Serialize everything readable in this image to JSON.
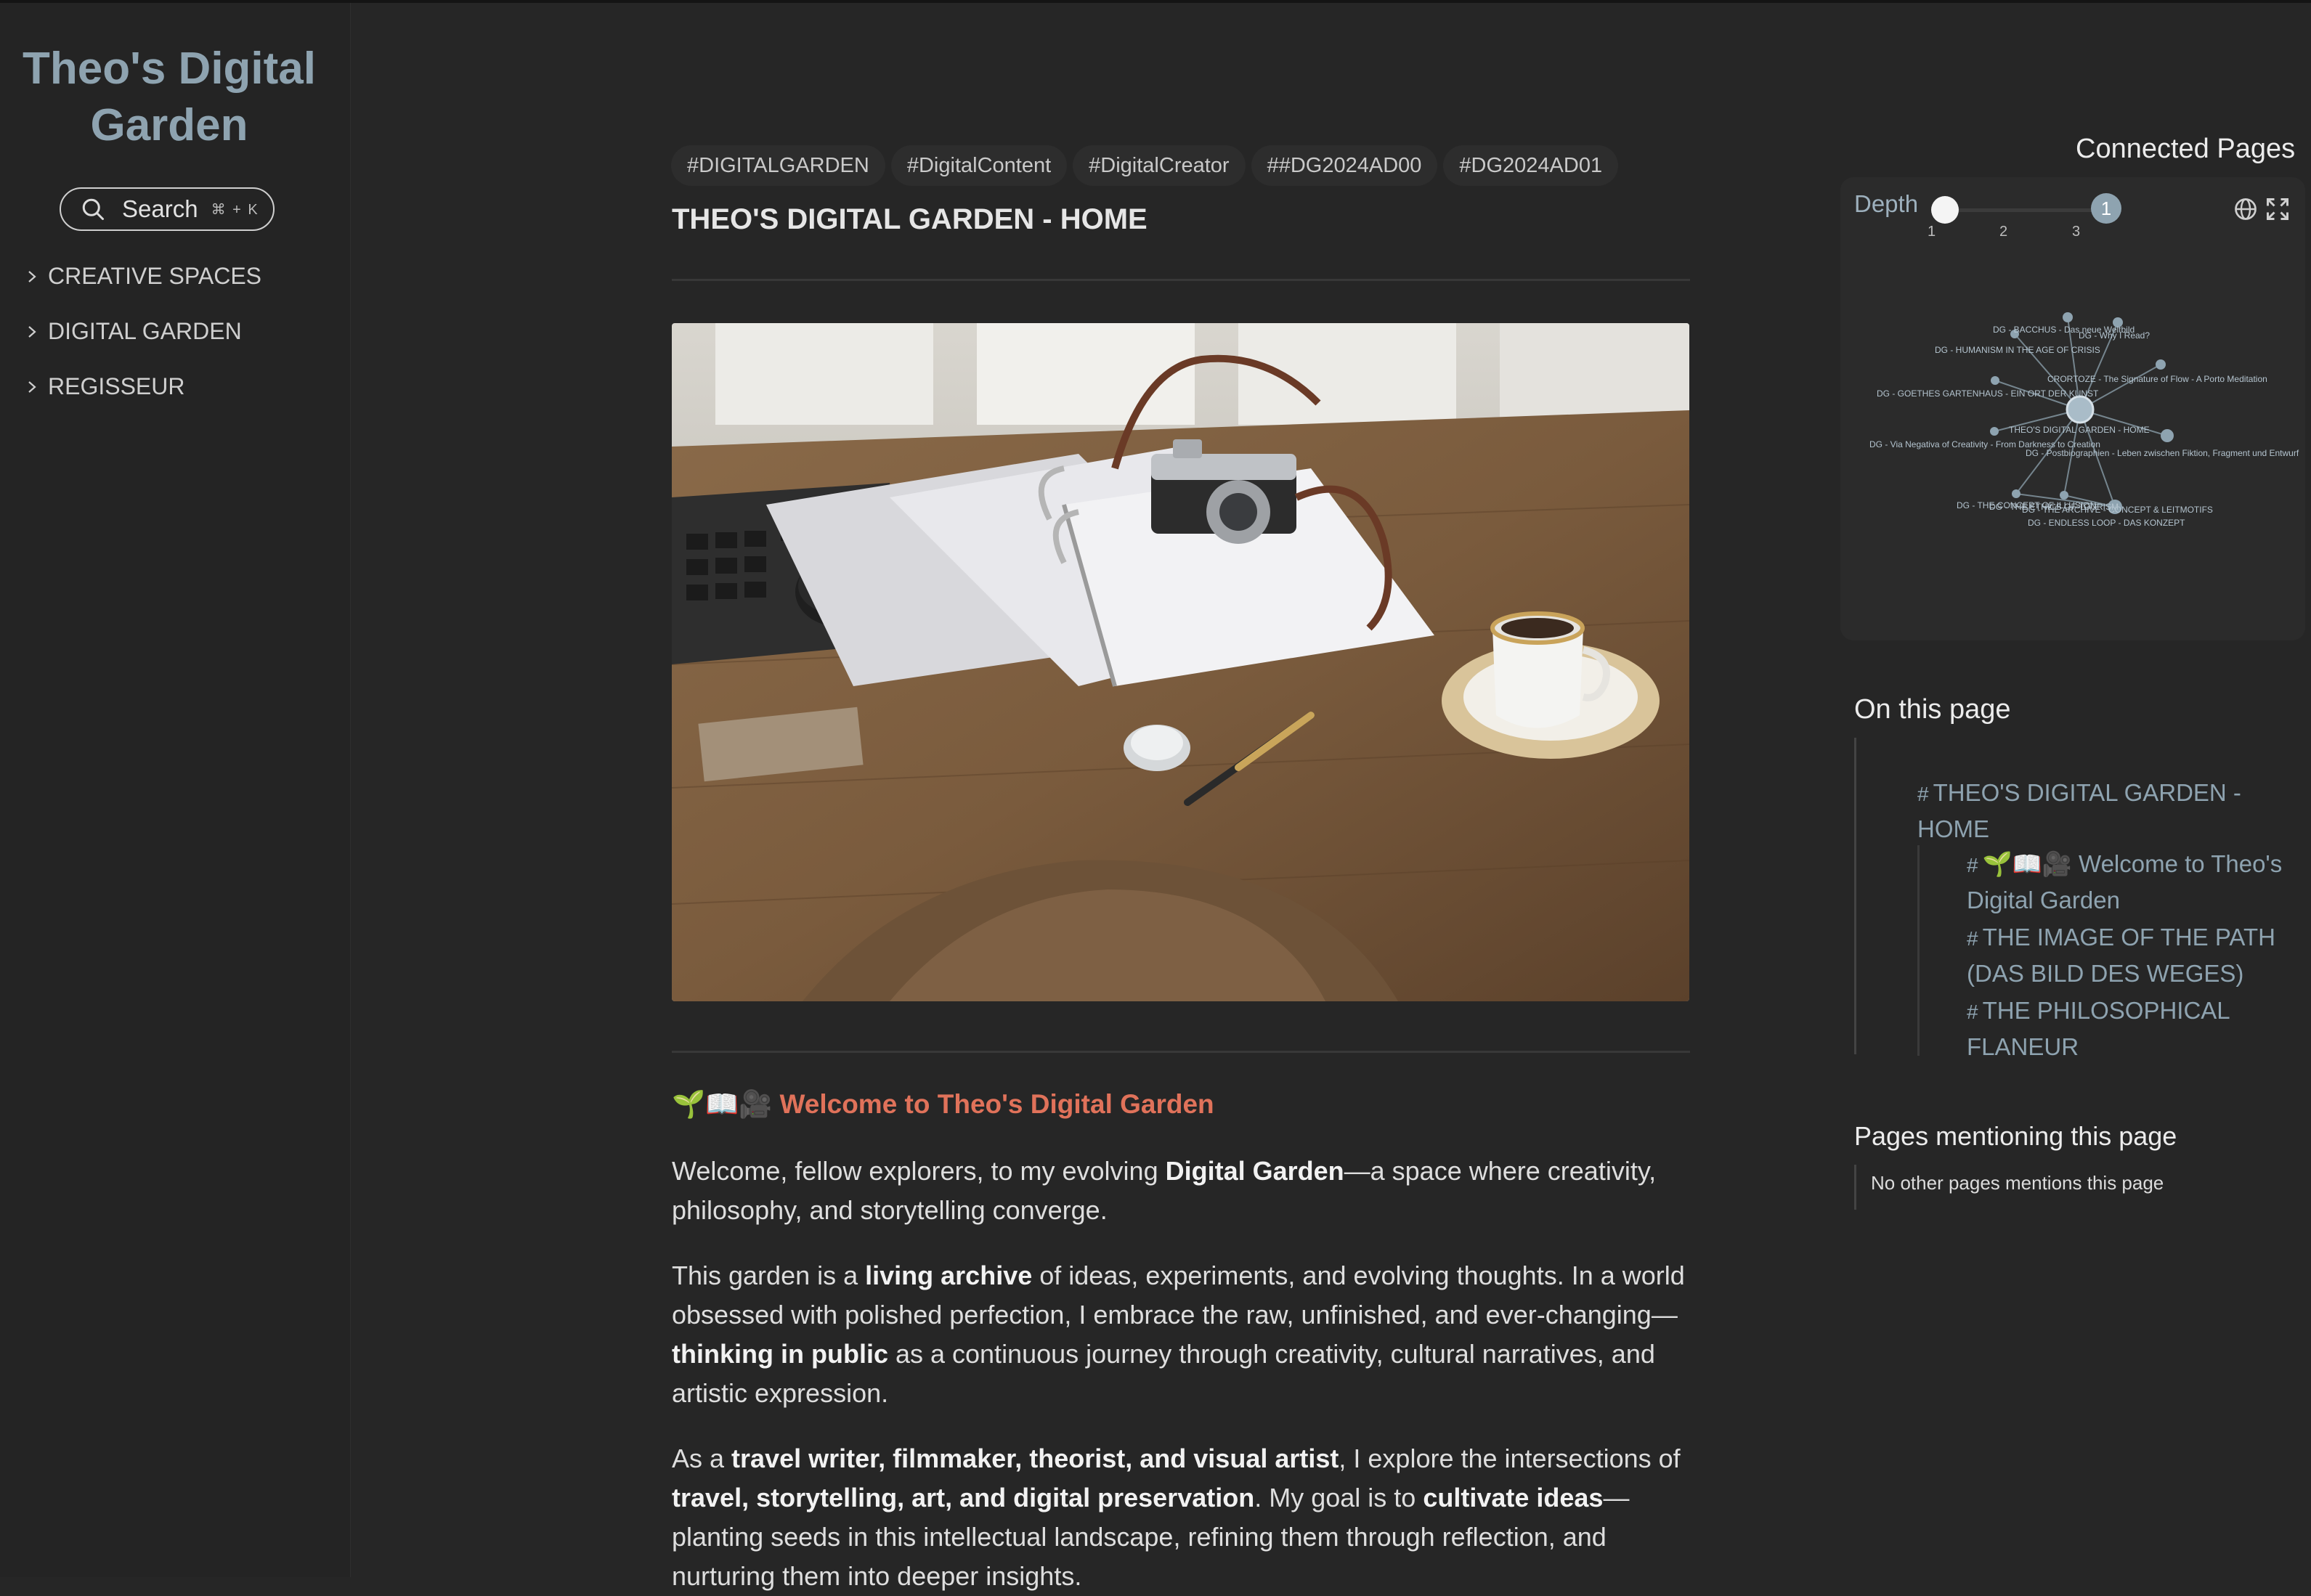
{
  "sidebar": {
    "title": "Theo's Digital Garden",
    "search_label": "Search",
    "search_shortcut": "⌘ + K",
    "nav_items": [
      {
        "label": "CREATIVE SPACES"
      },
      {
        "label": "DIGITAL GARDEN"
      },
      {
        "label": "REGISSEUR"
      }
    ]
  },
  "main": {
    "tags": [
      "#DIGITALGARDEN",
      "#DigitalContent",
      "#DigitalCreator",
      "##DG2024AD00",
      "#DG2024AD01"
    ],
    "page_title": "THEO'S DIGITAL GARDEN - HOME",
    "hero_image": "desk-with-camera-binder-coffee-photo",
    "welcome_heading_emoji": "🌱📖🎥",
    "welcome_heading": "Welcome to Theo's Digital Garden",
    "p1": {
      "a": "Welcome, fellow explorers, to my evolving ",
      "b": "Digital Garden",
      "c": "—a space where creativity, philosophy, and storytelling converge."
    },
    "p2": {
      "a": "This garden is a ",
      "b": "living archive",
      "c": " of ideas, experiments, and evolving thoughts. In a world obsessed with polished perfection, I embrace the raw, unfinished, and ever-changing—",
      "d": "thinking in public",
      "e": " as a continuous journey through creativity, cultural narratives, and artistic expression."
    },
    "p3": {
      "a": "As a ",
      "b": "travel writer, filmmaker, theorist, and visual artist",
      "c": ", I explore the intersections of ",
      "d": "travel, storytelling, art, and digital preservation",
      "e": ". My goal is to ",
      "f": "cultivate ideas",
      "g": "—planting seeds in this intellectual landscape, refining them through reflection, and nurturing them into deeper insights."
    }
  },
  "graph": {
    "title": "Connected Pages",
    "depth_label": "Depth",
    "depth_value": "1",
    "depth_ticks": [
      "1",
      "2",
      "3"
    ],
    "nodes": [
      {
        "label": "DG - BACCHUS - Das neue Weltbild"
      },
      {
        "label": "DG - Why I Read?"
      },
      {
        "label": "DG - HUMANISM IN THE AGE OF CRISIS"
      },
      {
        "label": "CRORTOZE - The Signature of Flow - A Porto Meditation"
      },
      {
        "label": "DG - GOETHES GARTENHAUS - EIN ORT DER KUNST"
      },
      {
        "label": "THEO'S DIGITAL GARDEN - HOME"
      },
      {
        "label": "DG - Via Negativa of Creativity - From Darkness to Creation"
      },
      {
        "label": "DG - Postbiographien - Leben zwischen Fiktion, Fragment und Entwurf"
      },
      {
        "label": "DG - THE CONCEPT OF ILLUSION"
      },
      {
        "label": "DG - THE ETHICS OF TOURISM"
      },
      {
        "label": "DG - THE ARCHIVE - CONCEPT & LEITMOTIFS"
      },
      {
        "label": "DG - ENDLESS LOOP - DAS KONZEPT"
      }
    ]
  },
  "toc": {
    "title": "On this page",
    "items": [
      {
        "label": "THEO'S DIGITAL GARDEN - HOME"
      },
      {
        "label": "🌱📖🎥 Welcome to Theo's Digital Garden"
      },
      {
        "label": "THE IMAGE OF THE PATH (DAS BILD DES WEGES)"
      },
      {
        "label": "THE PHILOSOPHICAL FLANEUR"
      }
    ]
  },
  "mentions": {
    "title": "Pages mentioning this page",
    "empty_text": "No other pages mentions this page"
  },
  "colors": {
    "background": "#262626",
    "accent": "#8ea3b0",
    "heading_accent": "#e0725a"
  }
}
